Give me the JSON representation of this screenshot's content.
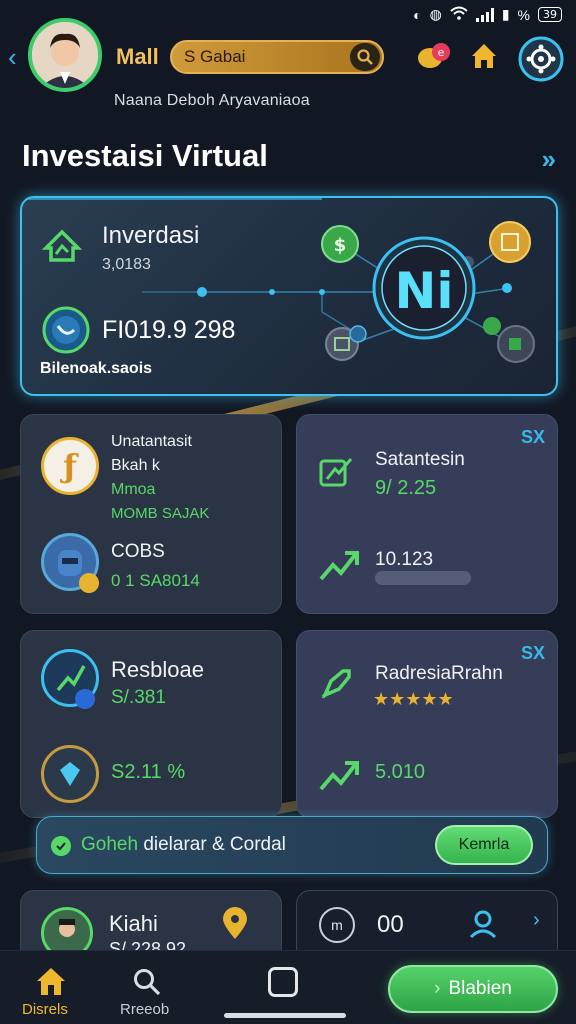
{
  "status_bar": {
    "battery": "39"
  },
  "header": {
    "app_title": "Mall",
    "search_value": "S Gabai",
    "user_name": "Naana Deboh  Aryavaniaoa"
  },
  "page_title": "Investaisi Virtual",
  "hero": {
    "label": "Inverdasi",
    "sub": "3,0183",
    "value": "FI019.9 298",
    "caption": "Bilenoak.saois",
    "center_badge": "Ni"
  },
  "card_a": {
    "title": "Unatantasit",
    "line2": "Bkah k",
    "line3": "Mmoa",
    "line4": "MOMB SAJAK",
    "row_label": "COBS",
    "row_value": "0 1 SA8014"
  },
  "card_b": {
    "badge": "SX",
    "title": "Satantesin",
    "value": "9/ 2.25",
    "row_value": "10.123"
  },
  "card_c": {
    "title": "Resbloae",
    "value": "S/.381",
    "row_value": "S2.11 %"
  },
  "card_d": {
    "badge": "SX",
    "title": "RadresiaRrahn",
    "stars": "★★★★★",
    "row_value": "5.010"
  },
  "banner": {
    "text_green": "Goheh",
    "text": " dielarar & Cordal",
    "button": "Kemrla"
  },
  "card_e": {
    "title": "Kiahi",
    "value": "S/ 228 92"
  },
  "card_f": {
    "value": "00"
  },
  "bottom_nav": {
    "items": [
      {
        "label": "Disrels",
        "icon": "home-icon"
      },
      {
        "label": "Rreeob",
        "icon": "search-icon"
      },
      {
        "label": "",
        "icon": "square-icon"
      }
    ],
    "primary_button": "Blabien"
  },
  "colors": {
    "accent_blue": "#3cc0f0",
    "accent_green": "#58d868",
    "accent_gold": "#d8a84a",
    "background": "#121823"
  }
}
